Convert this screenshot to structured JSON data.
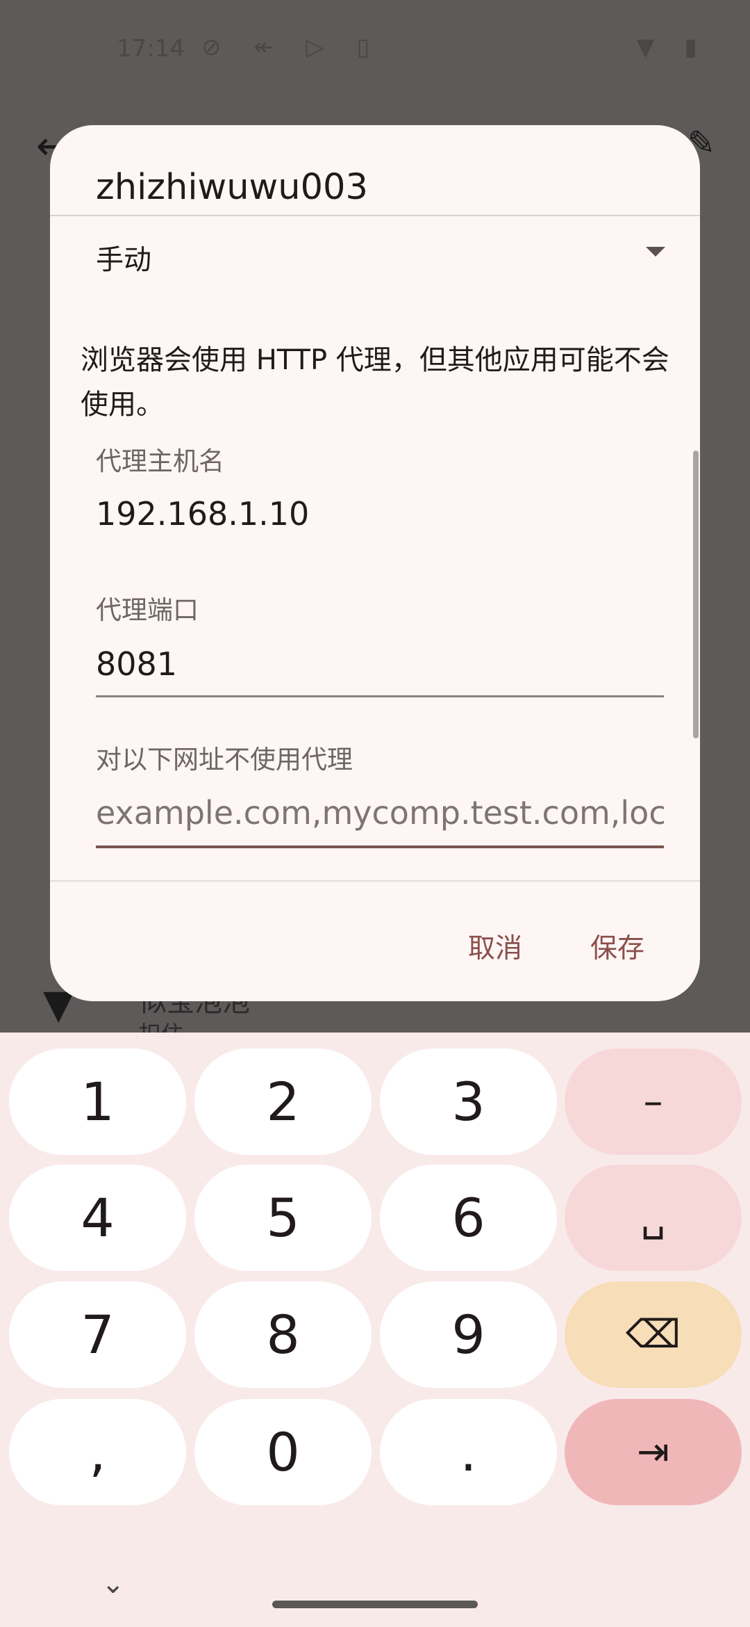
{
  "status_bar": {
    "time": "17:14",
    "icons": "⊘ ↞ ▷ ▯",
    "right_icons": "▼ ▮"
  },
  "background": {
    "network_title": "似宝泡泡",
    "network_subtitle": "扣住"
  },
  "dialog": {
    "title": "zhizhiwuwu003",
    "proxy_mode": "手动",
    "info_text": "浏览器会使用 HTTP 代理，但其他应用可能不会使用。",
    "fields": {
      "hostname_label": "代理主机名",
      "hostname_value": "192.168.1.10",
      "port_label": "代理端口",
      "port_value": "8081",
      "bypass_label": "对以下网址不使用代理",
      "bypass_placeholder": "example.com,mycomp.test.com,localhost"
    },
    "cancel_label": "取消",
    "save_label": "保存"
  },
  "keyboard": {
    "keys": [
      "1",
      "2",
      "3",
      "–",
      "4",
      "5",
      "6",
      "␣",
      "7",
      "8",
      "9",
      "⌫",
      ",",
      "0",
      ".",
      "⇥"
    ]
  },
  "colors": {
    "accent": "#8b4e4a",
    "keyboard_bg": "#f9eaea",
    "dialog_bg": "#fdf6f5"
  }
}
